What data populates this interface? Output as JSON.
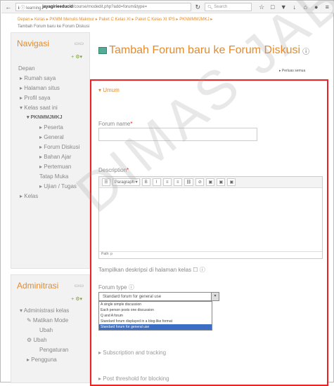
{
  "browser": {
    "url_prefix": "ℹ ⓘ learning.",
    "url_host": "jayagirieeducid",
    "url_rest": "/course/modedit.php?add=forum&type=",
    "search_placeholder": "Search"
  },
  "breadcrumb": {
    "items": [
      "Depan",
      "Kelas",
      "PKMM Menulis Makmur",
      "Paket C Kelas XI",
      "Paket C Kelas XI IPS",
      "PKNMMMJMKJ"
    ],
    "current": "Tambah Forum baru ke Forum Diskusi"
  },
  "blocks": {
    "navigasi": {
      "title": "Navigasi",
      "items": [
        {
          "label": "Depan",
          "level": "top"
        },
        {
          "label": "▸ Rumah saya",
          "level": "l1"
        },
        {
          "label": "▸ Halaman situs",
          "level": "l1"
        },
        {
          "label": "▸ Profil saya",
          "level": "l1"
        },
        {
          "label": "▾ Kelas saat ini",
          "level": "l1"
        },
        {
          "label": "▾ PKNMMJMKJ",
          "level": "l2b"
        },
        {
          "label": "▸ Peserta",
          "level": "l3"
        },
        {
          "label": "▸ General",
          "level": "l3"
        },
        {
          "label": "▸ Forum Diskusi",
          "level": "l3"
        },
        {
          "label": "▸ Bahan Ajar",
          "level": "l3"
        },
        {
          "label": "▸ Pertemuan",
          "level": "l3"
        },
        {
          "label": "Tatap Muka",
          "level": "l3"
        },
        {
          "label": "▸ Ujian / Tugas",
          "level": "l3"
        },
        {
          "label": "▸ Kelas",
          "level": "l1"
        }
      ]
    },
    "admin": {
      "title": "Adminitrasi",
      "items": [
        {
          "label": "▾ Administrasi kelas",
          "level": "l1"
        },
        {
          "label": "✎ Matikan Mode",
          "level": "l2"
        },
        {
          "label": "Ubah",
          "level": "l3"
        },
        {
          "label": "⚙ Ubah",
          "level": "l2"
        },
        {
          "label": "Pengaturan",
          "level": "l3"
        },
        {
          "label": "▸ Pengguna",
          "level": "l2"
        }
      ]
    }
  },
  "page": {
    "title": "Tambah Forum baru ke Forum Diskusi",
    "expand": "▸ Perluas semua"
  },
  "form": {
    "section_general": "▾ Umum",
    "forum_name_label": "Forum name",
    "req": "*",
    "description_label": "Description",
    "editor_buttons": [
      "☰",
      "Paragraph ▾",
      "B",
      "I",
      "≡",
      "≡",
      "⛓",
      "⊘",
      "▣",
      "▣",
      "▣"
    ],
    "editor_path": "Path: p",
    "show_desc_label": "Tampilkan deskripsi di halaman kelas",
    "forum_type_label": "Forum type",
    "forum_type_value": "Standard forum for general use",
    "forum_type_options": [
      "A single simple discussion",
      "Each person posts one discussion",
      "Q and A forum",
      "Standard forum displayed in a blog-like format",
      "Standard forum for general use"
    ],
    "forum_type_selected": 4,
    "section_subscription": "▸ Subscription and tracking",
    "section_threshold": "▸ Post threshold for blocking"
  },
  "watermark": "DIMAS JABA",
  "colors": {
    "accent": "#e58b2a",
    "required": "#e22222",
    "select_highlight": "#3b6fc4"
  }
}
